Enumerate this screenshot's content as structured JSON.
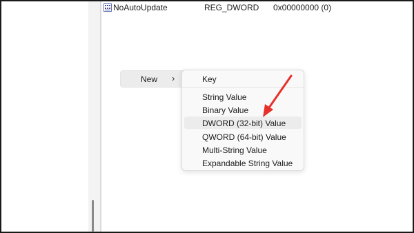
{
  "values_list": {
    "rows": [
      {
        "name": "NoAutoUpdate",
        "type": "REG_DWORD",
        "data": "0x00000000 (0)"
      }
    ]
  },
  "context_menu": {
    "new_label": "New",
    "new_chevron": "›"
  },
  "submenu": {
    "items": [
      {
        "label": "Key"
      },
      {
        "label": "String Value"
      },
      {
        "label": "Binary Value"
      },
      {
        "label": "DWORD (32-bit) Value"
      },
      {
        "label": "QWORD (64-bit) Value"
      },
      {
        "label": "Multi-String Value"
      },
      {
        "label": "Expandable String Value"
      }
    ],
    "highlighted_item": "DWORD (32-bit) Value"
  },
  "annotation": {
    "arrow_color": "#e8302a",
    "points_to": "DWORD (32-bit) Value"
  },
  "icons": {
    "registry_value": "reg-dword-icon",
    "submenu": "chevron-right-icon",
    "annotation": "red-arrow-icon"
  }
}
